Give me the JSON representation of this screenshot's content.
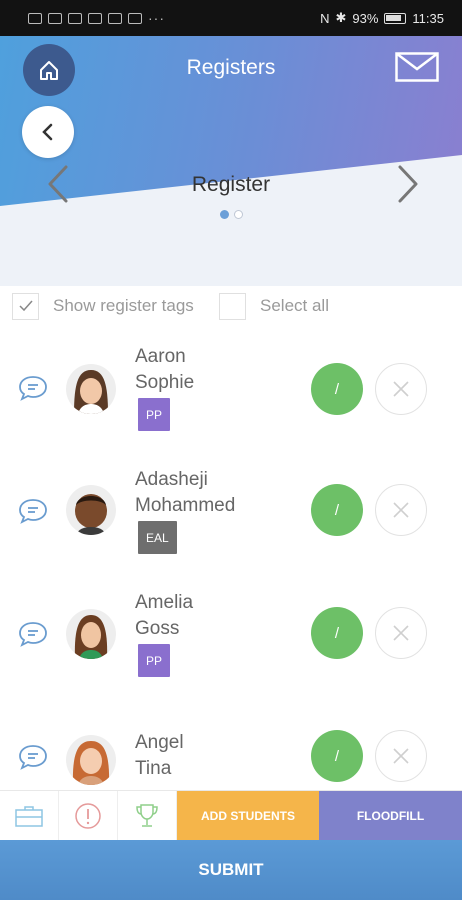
{
  "status_bar": {
    "battery": "93%",
    "time": "11:35"
  },
  "header": {
    "title": "Registers",
    "register_title": "Register"
  },
  "options": {
    "show_tags_label": "Show register tags",
    "show_tags_checked": true,
    "select_all_label": "Select all",
    "select_all_checked": false
  },
  "students": [
    {
      "first": "Aaron",
      "last": "Sophie",
      "tag": "PP",
      "tag_color": "#8a6fce",
      "present_mark": "/"
    },
    {
      "first": "Adasheji",
      "last": "Mohammed",
      "tag": "EAL",
      "tag_color": "#6e6e6e",
      "present_mark": "/"
    },
    {
      "first": "Amelia",
      "last": "Goss",
      "tag": "PP",
      "tag_color": "#8a6fce",
      "present_mark": "/"
    },
    {
      "first": "Angel",
      "last": "Tina",
      "tag": "",
      "tag_color": "",
      "present_mark": "/"
    }
  ],
  "toolbar": {
    "add_students_label": "ADD STUDENTS",
    "floodfill_label": "FLOODFILL"
  },
  "submit_label": "SUBMIT",
  "colors": {
    "present_green": "#6dc067",
    "accent_orange": "#f5b54a",
    "accent_purple": "#7f82cb",
    "submit_blue": "#5b9ad6"
  }
}
